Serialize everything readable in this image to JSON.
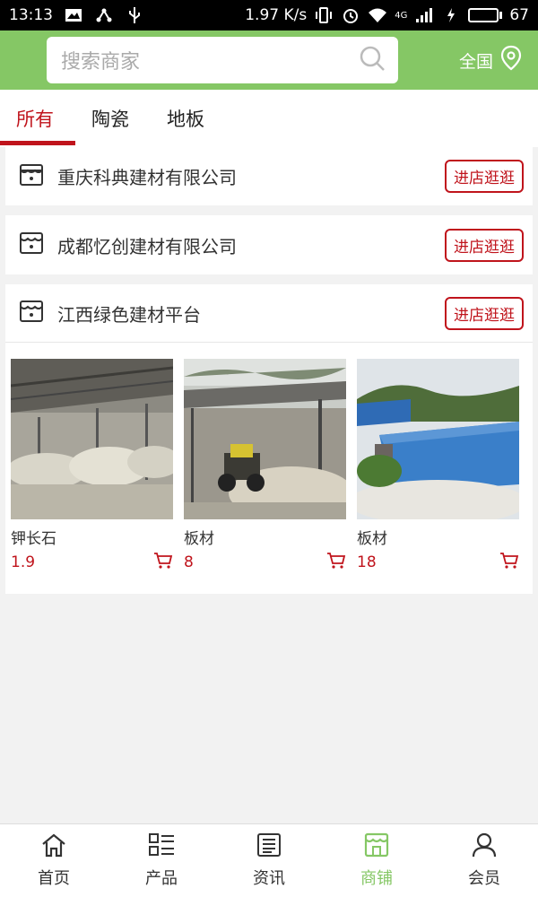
{
  "status_bar": {
    "time": "13:13",
    "speed": "1.97 K/s",
    "network": "4G",
    "battery": "67",
    "battery_level": 0.67
  },
  "header": {
    "search_placeholder": "搜索商家",
    "region_label": "全国"
  },
  "tabs": [
    {
      "label": "所有",
      "active": true
    },
    {
      "label": "陶瓷",
      "active": false
    },
    {
      "label": "地板",
      "active": false
    }
  ],
  "stores": [
    {
      "name": "重庆科典建材有限公司",
      "button_label": "进店逛逛"
    },
    {
      "name": "成都忆创建材有限公司",
      "button_label": "进店逛逛"
    },
    {
      "name": "江西绿色建材平台",
      "button_label": "进店逛逛"
    }
  ],
  "products": [
    {
      "name": "钾长石",
      "price": "1.9"
    },
    {
      "name": "板材",
      "price": "8"
    },
    {
      "name": "板材",
      "price": "18"
    }
  ],
  "bottom_nav": [
    {
      "label": "首页",
      "icon": "home-icon",
      "active": false
    },
    {
      "label": "产品",
      "icon": "product-list-icon",
      "active": false
    },
    {
      "label": "资讯",
      "icon": "news-icon",
      "active": false
    },
    {
      "label": "商铺",
      "icon": "store-icon",
      "active": true
    },
    {
      "label": "会员",
      "icon": "user-icon",
      "active": false
    }
  ],
  "colors": {
    "brand_green": "#85c765",
    "accent_red": "#c0141c"
  }
}
